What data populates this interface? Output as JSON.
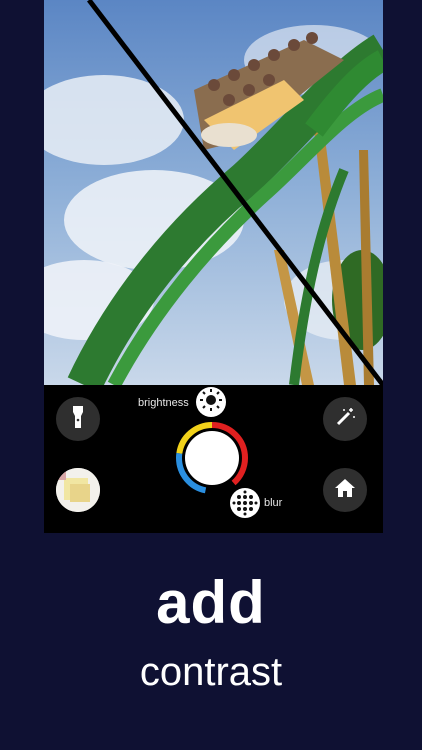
{
  "controls": {
    "brightness_label": "brightness",
    "blur_label": "blur",
    "flashlight_icon": "flashlight-icon",
    "magic_wand_icon": "magic-wand-icon",
    "home_icon": "home-icon",
    "sun_icon": "sun-icon",
    "blur_icon": "blur-dots-icon"
  },
  "caption": {
    "title": "add",
    "subtitle": "contrast"
  },
  "colors": {
    "background": "#0f1133",
    "dial_red": "#e02020",
    "dial_yellow": "#f2d21a",
    "dial_blue": "#2a8fe0"
  }
}
